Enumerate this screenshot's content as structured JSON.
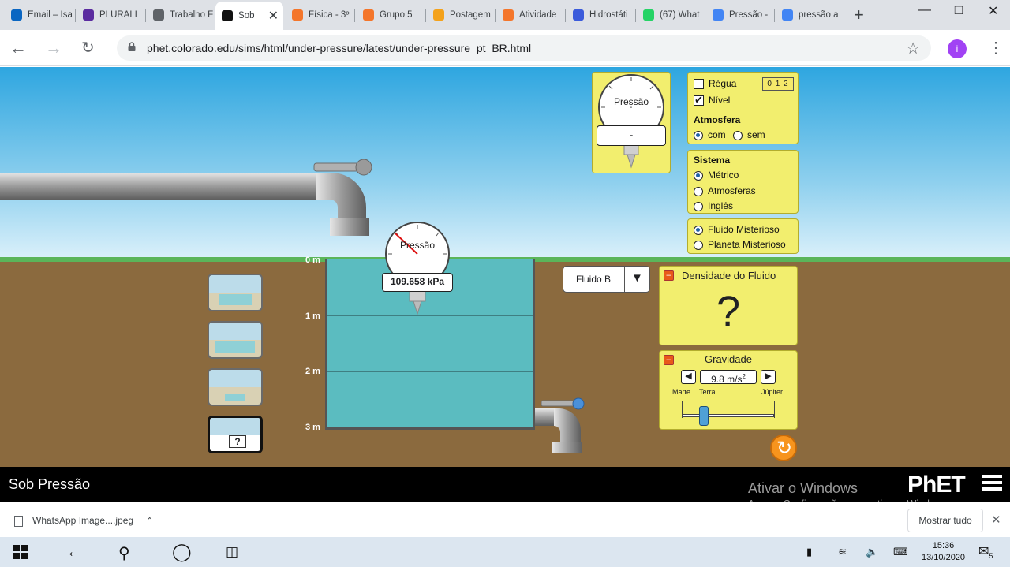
{
  "browser": {
    "tabs": [
      {
        "label": "Email – Isa",
        "color": "#0a66c2"
      },
      {
        "label": "PLURALL",
        "color": "#5b2ca0"
      },
      {
        "label": "Trabalho F",
        "color": "#5f6368"
      },
      {
        "label": "Sob",
        "color": "#111111"
      },
      {
        "label": "Física - 3º",
        "color": "#f4762b"
      },
      {
        "label": "Grupo 5",
        "color": "#f4762b"
      },
      {
        "label": "Postagem",
        "color": "#f4a21b"
      },
      {
        "label": "Atividade",
        "color": "#f4762b"
      },
      {
        "label": "Hidrostáti",
        "color": "#3b5bdb"
      },
      {
        "label": "(67) What",
        "color": "#25d366"
      },
      {
        "label": "Pressão -",
        "color": "#4285f4"
      },
      {
        "label": "pressão a",
        "color": "#4285f4"
      }
    ],
    "url": "phet.colorado.edu/sims/html/under-pressure/latest/under-pressure_pt_BR.html",
    "profile_initial": "i"
  },
  "sim": {
    "title": "Sob Pressão",
    "gauge_top": {
      "label": "Pressão",
      "dot": "-",
      "value": "-"
    },
    "gauge_tank": {
      "label": "Pressão",
      "value": "109.658 kPa"
    },
    "depth_labels": [
      "0 m",
      "1 m",
      "2 m",
      "3 m"
    ],
    "controls": {
      "ruler_label": "Régua",
      "ruler_icon_text": "0 1 2",
      "level_label": "Nível",
      "atmosphere_title": "Atmosfera",
      "atm_on": "com",
      "atm_off": "sem"
    },
    "system": {
      "title": "Sistema",
      "options": [
        "Métrico",
        "Atmosferas",
        "Inglês"
      ],
      "selected": 0
    },
    "mystery": {
      "options": [
        "Fluido Misterioso",
        "Planeta Misterioso"
      ],
      "selected": 0
    },
    "fluid_select": "Fluido B",
    "density": {
      "title": "Densidade do Fluido",
      "value": "?"
    },
    "gravity": {
      "title": "Gravidade",
      "value": "9.8 m/s",
      "unit_sup": "2",
      "labels": [
        "Marte",
        "Terra",
        "Júpiter"
      ],
      "level_fraction": 0.24
    },
    "scene_question": "?"
  },
  "footer": {
    "title": "Sob Pressão",
    "activate": "Ativar o Windows",
    "activate_sub": "Acesse Configurações para ativar o Windows.",
    "phet": "PhET"
  },
  "downloads": {
    "file": "WhatsApp Image....jpeg",
    "show_all": "Mostrar tudo"
  },
  "taskbar": {
    "time": "15:36",
    "date": "13/10/2020",
    "notifications": "5"
  }
}
